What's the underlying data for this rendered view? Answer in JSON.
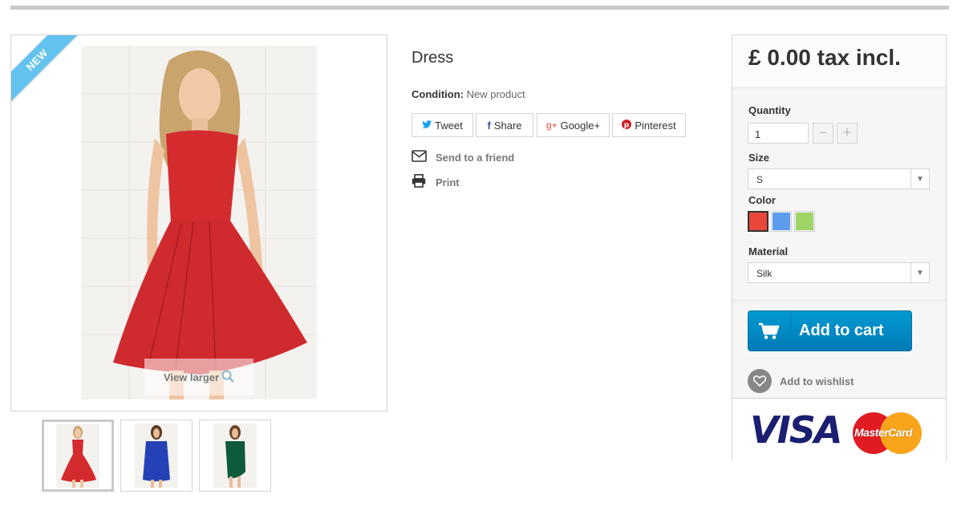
{
  "product": {
    "badge": "NEW",
    "title": "Dress",
    "condition_label": "Condition:",
    "condition_value": "New product",
    "view_larger": "View larger"
  },
  "social": {
    "tweet": "Tweet",
    "share": "Share",
    "google": "Google+",
    "pinterest": "Pinterest"
  },
  "links": {
    "send_to_friend": "Send to a friend",
    "print": "Print"
  },
  "buy": {
    "price": "£ 0.00 tax incl.",
    "quantity_label": "Quantity",
    "quantity_value": "1",
    "size_label": "Size",
    "size_value": "S",
    "color_label": "Color",
    "colors": [
      "#e8473a",
      "#5d9cec",
      "#a0d468"
    ],
    "selected_color_index": 0,
    "material_label": "Material",
    "material_value": "Silk",
    "add_to_cart": "Add to cart",
    "add_to_wishlist": "Add to wishlist"
  },
  "payment": {
    "visa": "VISA",
    "mastercard": "MasterCard"
  },
  "colors": {
    "accent_blue": "#0089c6",
    "ribbon": "#64c2ee",
    "dress_red": "#d42b2f",
    "dress_blue": "#2441b6",
    "dress_green": "#0e5a3c"
  }
}
